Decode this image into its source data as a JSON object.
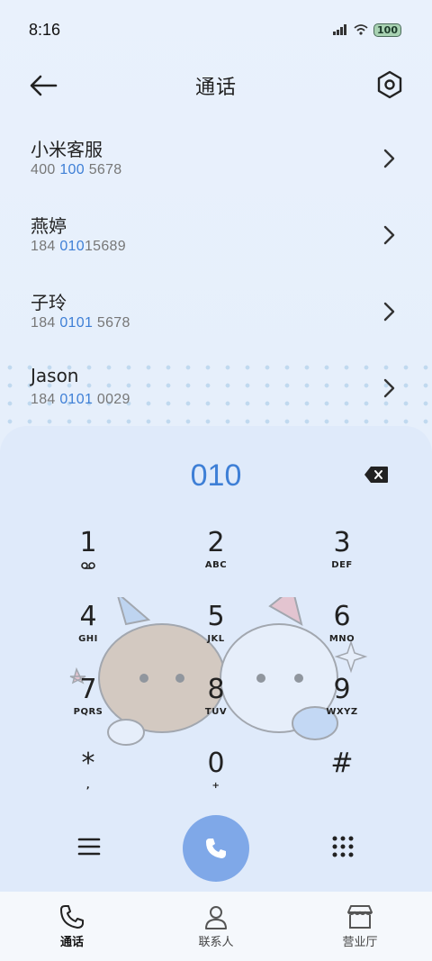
{
  "status": {
    "time": "8:16",
    "battery": "100"
  },
  "header": {
    "title": "通话"
  },
  "contacts": [
    {
      "name": "小米客服",
      "num_pre": "400 ",
      "num_hl": "100",
      "num_post": " 5678"
    },
    {
      "name": "燕婷",
      "num_pre": "184 ",
      "num_hl": "010",
      "num_post": "15689"
    },
    {
      "name": "子玲",
      "num_pre": "184 ",
      "num_hl": "0101",
      "num_post": " 5678"
    },
    {
      "name": "Jason",
      "num_pre": "184 ",
      "num_hl": "0101",
      "num_post": " 0029"
    }
  ],
  "dialpad": {
    "input": "010",
    "keys": [
      {
        "digit": "1",
        "letters": ""
      },
      {
        "digit": "2",
        "letters": "ABC"
      },
      {
        "digit": "3",
        "letters": "DEF"
      },
      {
        "digit": "4",
        "letters": "GHI"
      },
      {
        "digit": "5",
        "letters": "JKL"
      },
      {
        "digit": "6",
        "letters": "MNO"
      },
      {
        "digit": "7",
        "letters": "PQRS"
      },
      {
        "digit": "8",
        "letters": "TUV"
      },
      {
        "digit": "9",
        "letters": "WXYZ"
      },
      {
        "digit": "*",
        "letters": ","
      },
      {
        "digit": "0",
        "letters": "+"
      },
      {
        "digit": "#",
        "letters": ""
      }
    ]
  },
  "nav": {
    "calls": "通话",
    "contacts": "联系人",
    "store": "营业厅"
  },
  "colors": {
    "accent": "#3e7fd6",
    "call_button": "#7fa8e8"
  }
}
